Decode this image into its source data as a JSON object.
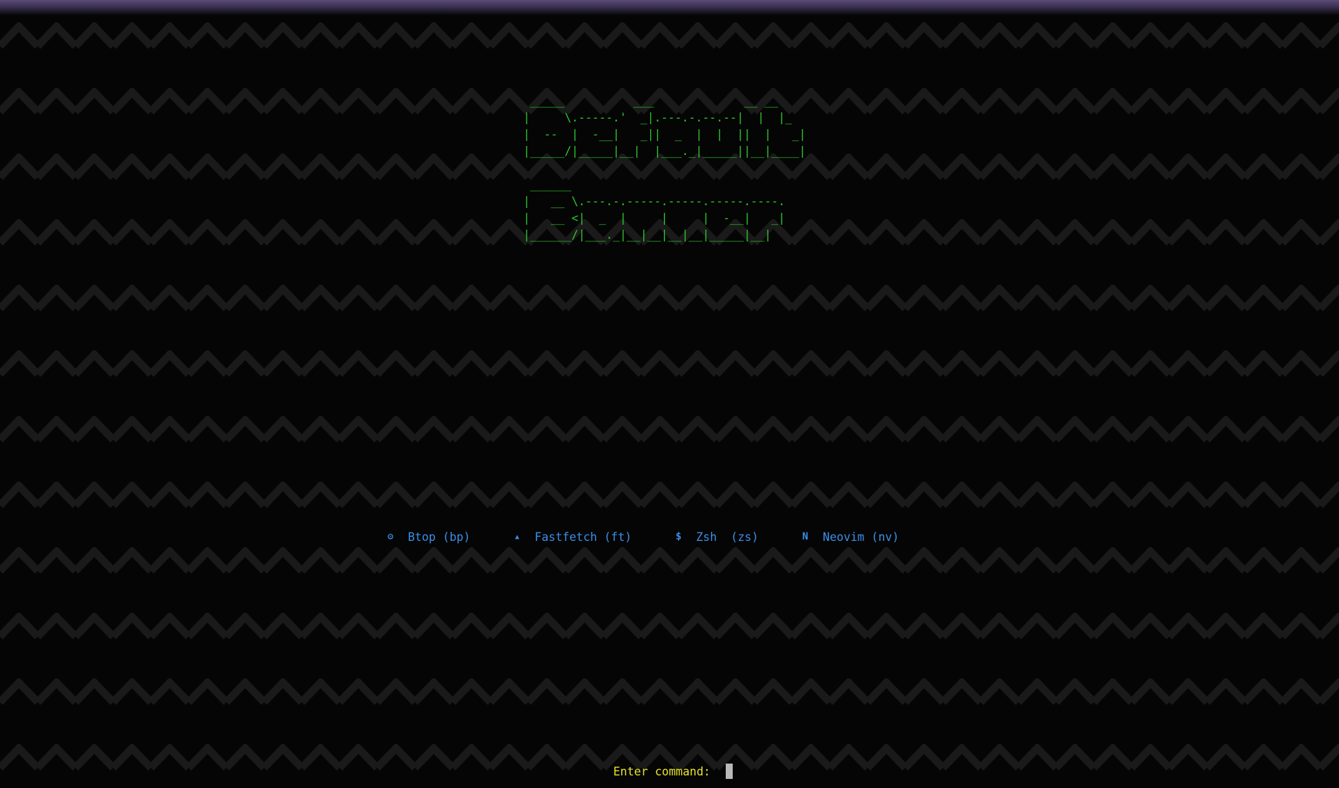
{
  "banner": {
    "line1": " _____          ___             __ __ \n|     \\.-----.'  _|.---.-.--.--|  |  |_\n|  --  |  -__|   _||  _  |  |  ||  |   _|\n|_____/|_____|__|  |___._|_____||__|____|",
    "line2": " ______\n|   __ \\.---.-.-----.-----.-----.----.\n|   __ <|  _  |     |     |  -__|   _|\n|______/|___._|__|__|__|__|_____|__|"
  },
  "menu": {
    "items": [
      {
        "icon": "gear-icon",
        "glyph": "⚙",
        "label": "Btop (bp)"
      },
      {
        "icon": "arch-icon",
        "glyph": "▲",
        "label": "Fastfetch (ft)"
      },
      {
        "icon": "dollar-icon",
        "glyph": "$",
        "label": "Zsh  (zs)"
      },
      {
        "icon": "neovim-icon",
        "glyph": "N",
        "label": "Neovim (nv)"
      }
    ]
  },
  "prompt": {
    "label": "Enter command: "
  },
  "colors": {
    "background": "#050505",
    "ascii": "#2ec52e",
    "menu": "#3a8fe8",
    "prompt": "#e7e22c",
    "zigzag": "#1a1a1a"
  }
}
